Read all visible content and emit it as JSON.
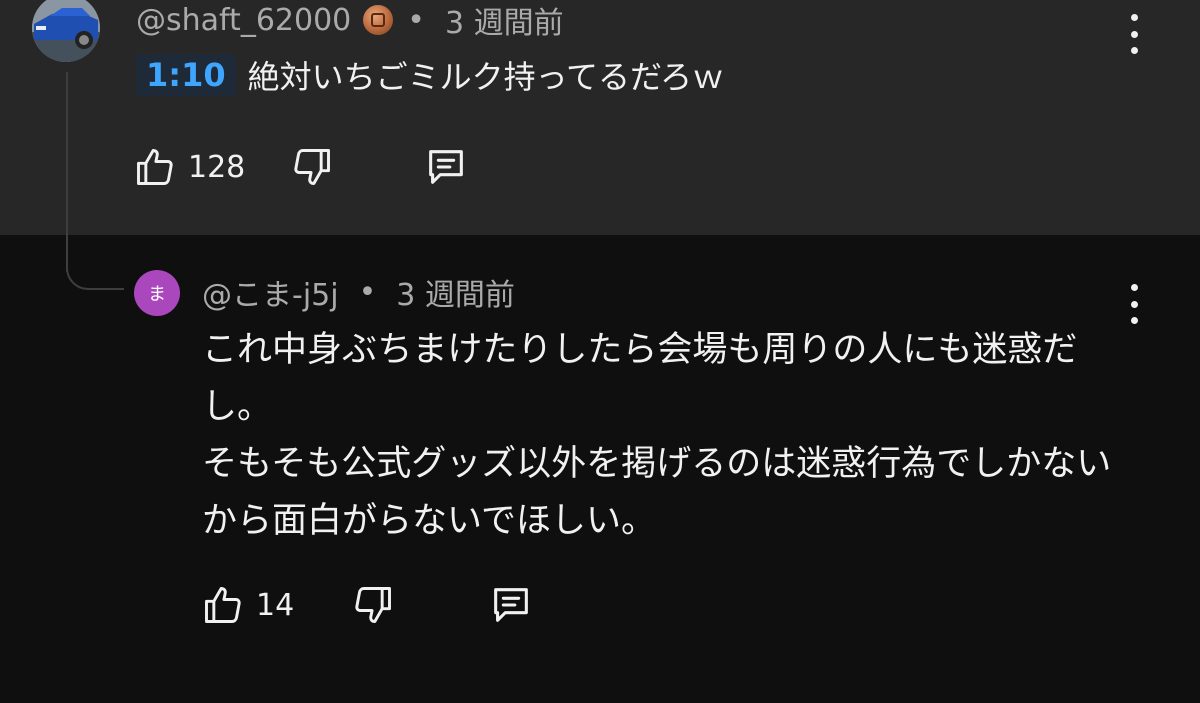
{
  "comment": {
    "author": "@shaft_62000",
    "separator": "•",
    "time": "3 週間前",
    "timestamp_link": "1:10",
    "text": "絶対いちごミルク持ってるだろｗ",
    "like_count": "128",
    "badge_icon": "member-badge-icon"
  },
  "reply": {
    "avatar_letter": "ま",
    "avatar_color": "#ab47bc",
    "author": "@こま-j5j",
    "separator": "•",
    "time": "3 週間前",
    "lines": [
      "これ中身ぶちまけたりしたら会場も周りの人にも迷惑だし。",
      "そもそも公式グッズ以外を掲げるのは迷惑行為でしかないから面白がらないでほしい。"
    ],
    "like_count": "14"
  },
  "colors": {
    "top_bg": "#272727",
    "reply_bg": "#0f0f0f",
    "timestamp_link": "#3ea6ff",
    "meta_text": "#aaaaaa"
  }
}
